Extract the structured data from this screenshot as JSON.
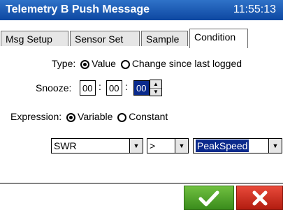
{
  "titlebar": {
    "title": "Telemetry B Push Message",
    "time": "11:55:13"
  },
  "tabs": [
    {
      "label": "Msg Setup",
      "active": false
    },
    {
      "label": "Sensor Set",
      "active": false
    },
    {
      "label": "Sample",
      "active": false
    },
    {
      "label": "Condition",
      "active": true
    }
  ],
  "condition": {
    "type_label": "Type:",
    "type_options": [
      {
        "label": "Value",
        "selected": true
      },
      {
        "label": "Change since last logged",
        "selected": false
      }
    ],
    "snooze_label": "Snooze:",
    "snooze": {
      "hours": "00",
      "minutes": "00",
      "seconds": "00",
      "sep": ":"
    },
    "expression_label": "Expression:",
    "expression_options": [
      {
        "label": "Variable",
        "selected": true
      },
      {
        "label": "Constant",
        "selected": false
      }
    ],
    "left_operand": "SWR",
    "operator": ">",
    "right_operand": "PeakSpeed"
  },
  "buttons": {
    "ok_icon": "checkmark-icon",
    "cancel_icon": "x-icon"
  },
  "colors": {
    "title_bar": "#0d47a1",
    "ok": "#3a8c1c",
    "cancel": "#b21c10",
    "selection": "#0a2a8c"
  }
}
